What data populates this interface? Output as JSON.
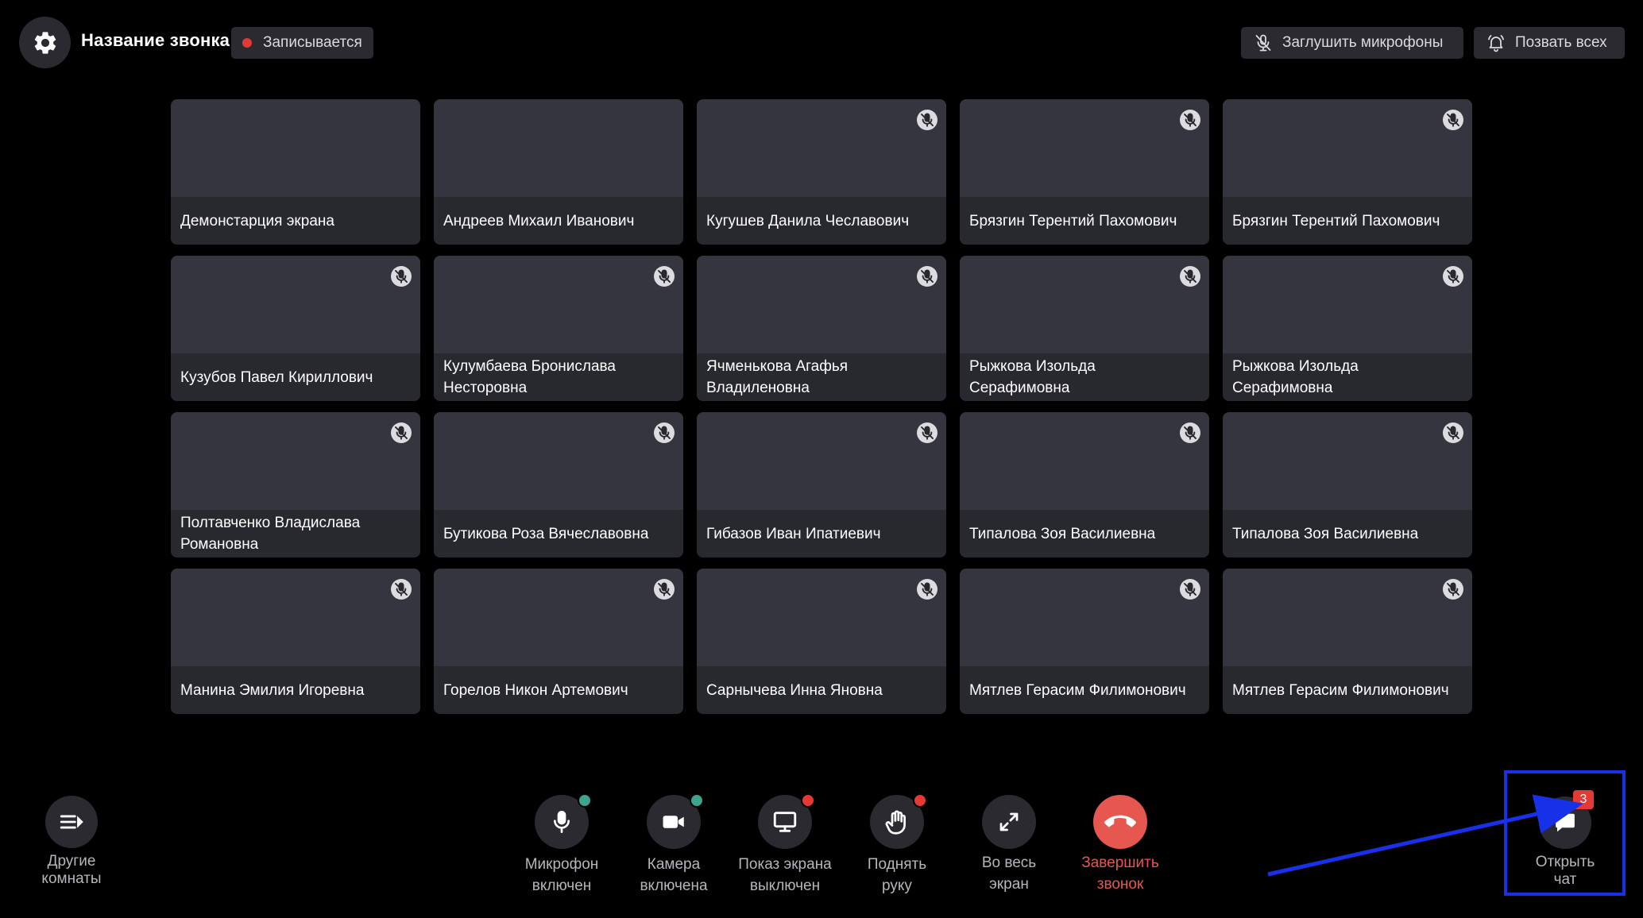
{
  "header": {
    "title": "Название звонка",
    "recording_label": "Записывается",
    "mute_all_label": "Заглушить микрофоны",
    "call_all_label": "Позвать всех"
  },
  "tiles": [
    {
      "name": "Демонстарция экрана",
      "muted": false
    },
    {
      "name": "Андреев Михаил Иванович",
      "muted": false
    },
    {
      "name": "Кугушев Данила Чеславович",
      "muted": true
    },
    {
      "name": "Брязгин Терентий Пахомович",
      "muted": true
    },
    {
      "name": "Брязгин Терентий Пахомович",
      "muted": true
    },
    {
      "name": "Кузубов Павел Кириллович",
      "muted": true
    },
    {
      "name": "Кулумбаева Бронислава Несторовна",
      "muted": true
    },
    {
      "name": "Ячменькова Агафья Владиленовна",
      "muted": true
    },
    {
      "name": "Рыжкова Изольда Серафимовна",
      "muted": true
    },
    {
      "name": "Рыжкова Изольда Серафимовна",
      "muted": true
    },
    {
      "name": "Полтавченко Владислава Романовна",
      "muted": true
    },
    {
      "name": "Бутикова Роза Вячеславовна",
      "muted": true
    },
    {
      "name": "Гибазов Иван Ипатиевич",
      "muted": true
    },
    {
      "name": "Типалова Зоя Василиевна",
      "muted": true
    },
    {
      "name": "Типалова Зоя Василиевна",
      "muted": true
    },
    {
      "name": "Манина Эмилия Игоревна",
      "muted": true
    },
    {
      "name": "Горелов Никон Артемович",
      "muted": true
    },
    {
      "name": "Сарнычева Инна Яновна",
      "muted": true
    },
    {
      "name": "Мятлев Герасим Филимонович",
      "muted": true
    },
    {
      "name": "Мятлев Герасим Филимонович",
      "muted": true
    }
  ],
  "controls": {
    "other_rooms": "Другие\nкомнаты",
    "mic": "Микрофон\nвключен",
    "camera": "Камера\nвключена",
    "screen": "Показ экрана\nвыключен",
    "hand": "Поднять\nруку",
    "fullscreen": "Во весь\nэкран",
    "end_call": "Завершить\nзвонок",
    "chat": "Открыть\nчат",
    "chat_unread": "3"
  },
  "colors": {
    "background": "#000000",
    "tile": "#35353f",
    "tile_name_bar": "#28282f",
    "status_on": "#3fa38d",
    "status_off": "#e53935",
    "end_call": "#e6574f",
    "annotation": "#1631e8"
  }
}
